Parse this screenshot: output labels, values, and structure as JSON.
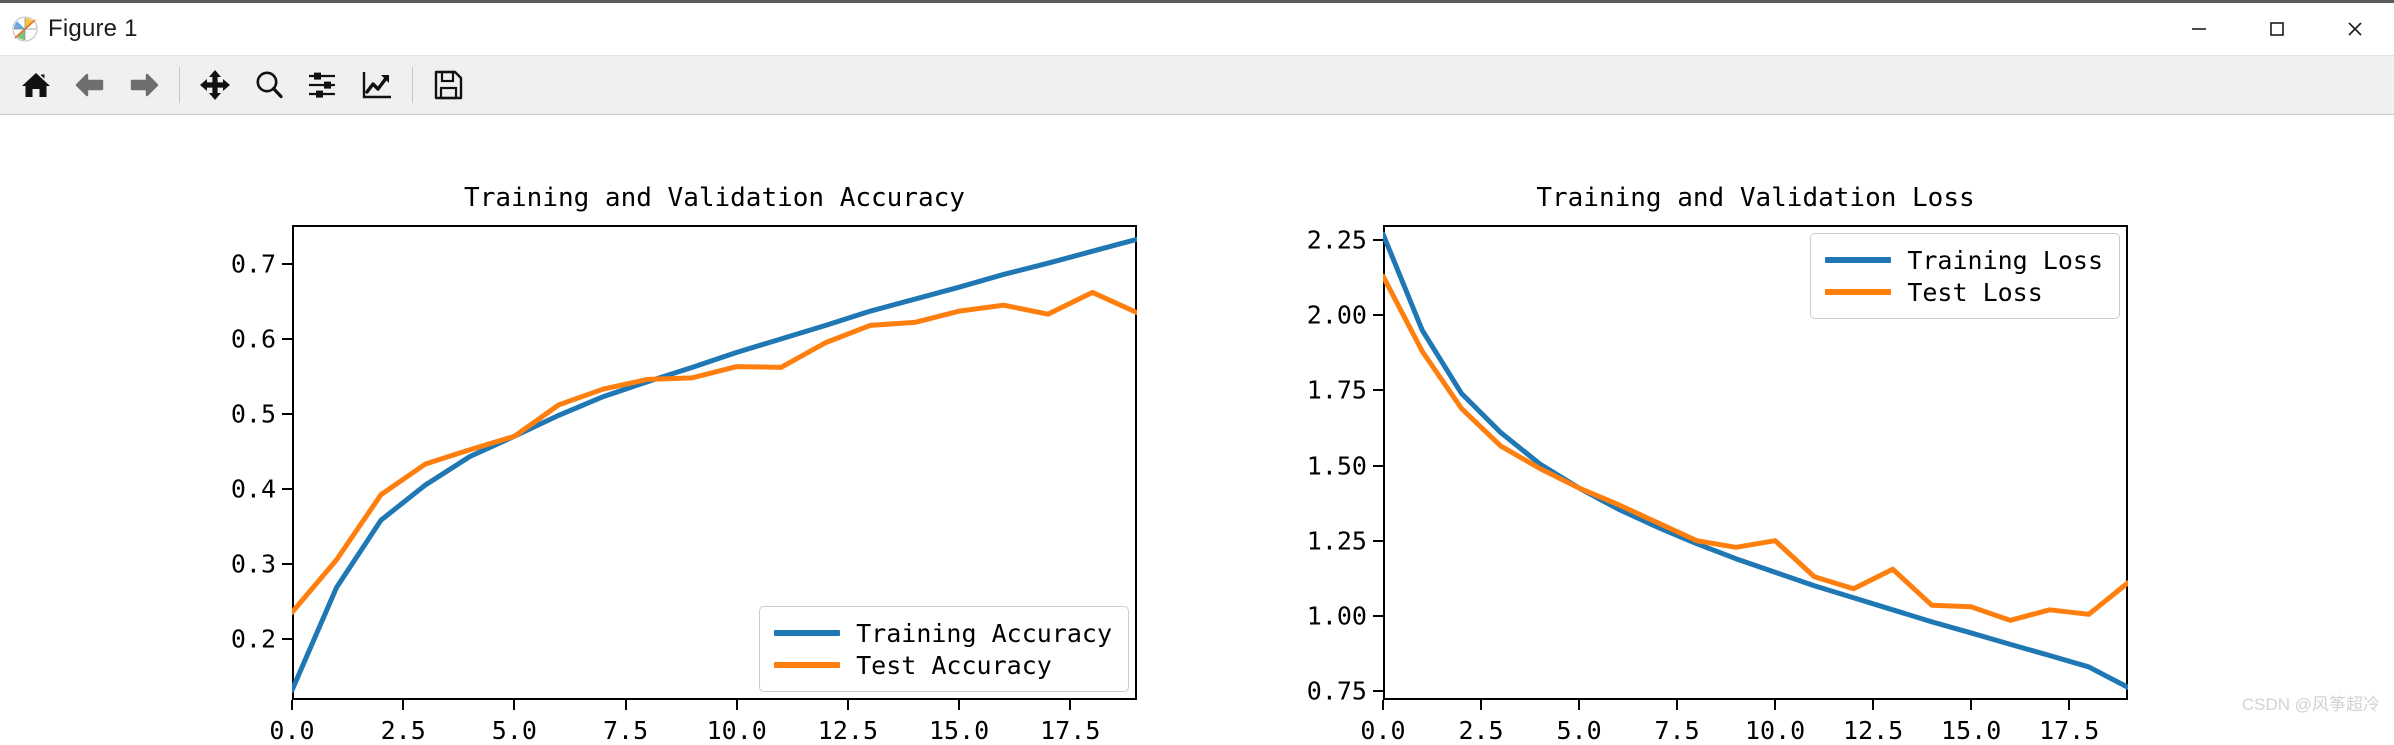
{
  "window": {
    "title": "Figure 1",
    "app_icon": "matplotlib-icon",
    "controls": {
      "minimize": "minimize-icon",
      "maximize": "maximize-icon",
      "close": "close-icon"
    }
  },
  "toolbar": {
    "buttons": [
      {
        "name": "home-button",
        "icon": "home-icon",
        "tooltip": "Reset original view",
        "enabled": true
      },
      {
        "name": "back-button",
        "icon": "arrow-left-icon",
        "tooltip": "Back to previous view",
        "enabled": false
      },
      {
        "name": "forward-button",
        "icon": "arrow-right-icon",
        "tooltip": "Forward to next view",
        "enabled": false
      },
      {
        "name": "pan-button",
        "icon": "move-icon",
        "tooltip": "Pan axes with left mouse, zoom with right",
        "enabled": true
      },
      {
        "name": "zoom-button",
        "icon": "magnifier-icon",
        "tooltip": "Zoom to rectangle",
        "enabled": true
      },
      {
        "name": "configure-subplots-button",
        "icon": "sliders-icon",
        "tooltip": "Configure subplots",
        "enabled": true
      },
      {
        "name": "edit-curves-button",
        "icon": "line-chart-icon",
        "tooltip": "Edit axis, curve and image parameters",
        "enabled": true
      },
      {
        "name": "save-button",
        "icon": "floppy-disk-icon",
        "tooltip": "Save the figure",
        "enabled": true
      }
    ]
  },
  "watermark": "CSDN @风筝超冷",
  "colors": {
    "training": "#1f77b4",
    "test": "#ff7f0e",
    "axis": "#000000",
    "toolbar_bg": "#f0f0f0",
    "disabled_icon": "#6e6e6e"
  },
  "chart_data": [
    {
      "type": "line",
      "title": "Training and Validation Accuracy",
      "xlabel": "",
      "ylabel": "",
      "xlim": [
        0,
        19
      ],
      "ylim": [
        0.118,
        0.752
      ],
      "grid": false,
      "legend_position": "lower right",
      "xticks": [
        "0.0",
        "2.5",
        "5.0",
        "7.5",
        "10.0",
        "12.5",
        "15.0",
        "17.5"
      ],
      "xtick_values": [
        0,
        2.5,
        5,
        7.5,
        10,
        12.5,
        15,
        17.5
      ],
      "yticks": [
        "0.2",
        "0.3",
        "0.4",
        "0.5",
        "0.6",
        "0.7"
      ],
      "ytick_values": [
        0.2,
        0.3,
        0.4,
        0.5,
        0.6,
        0.7
      ],
      "x": [
        0,
        1,
        2,
        3,
        4,
        5,
        6,
        7,
        8,
        9,
        10,
        11,
        12,
        13,
        14,
        15,
        16,
        17,
        18,
        19
      ],
      "series": [
        {
          "name": "Training Accuracy",
          "color": "#1f77b4",
          "values": [
            0.131,
            0.268,
            0.358,
            0.405,
            0.443,
            0.47,
            0.498,
            0.523,
            0.543,
            0.562,
            0.582,
            0.6,
            0.618,
            0.637,
            0.653,
            0.669,
            0.686,
            0.701,
            0.717,
            0.733
          ]
        },
        {
          "name": "Test Accuracy",
          "color": "#ff7f0e",
          "values": [
            0.235,
            0.305,
            0.392,
            0.433,
            0.452,
            0.47,
            0.512,
            0.533,
            0.546,
            0.548,
            0.563,
            0.562,
            0.595,
            0.618,
            0.622,
            0.637,
            0.645,
            0.633,
            0.662,
            0.635
          ]
        }
      ]
    },
    {
      "type": "line",
      "title": "Training and Validation Loss",
      "xlabel": "",
      "ylabel": "",
      "xlim": [
        0,
        19
      ],
      "ylim": [
        0.72,
        2.3
      ],
      "grid": false,
      "legend_position": "upper right",
      "xticks": [
        "0.0",
        "2.5",
        "5.0",
        "7.5",
        "10.0",
        "12.5",
        "15.0",
        "17.5"
      ],
      "xtick_values": [
        0,
        2.5,
        5,
        7.5,
        10,
        12.5,
        15,
        17.5
      ],
      "yticks": [
        "0.75",
        "1.00",
        "1.25",
        "1.50",
        "1.75",
        "2.00",
        "2.25"
      ],
      "ytick_values": [
        0.75,
        1.0,
        1.25,
        1.5,
        1.75,
        2.0,
        2.25
      ],
      "x": [
        0,
        1,
        2,
        3,
        4,
        5,
        6,
        7,
        8,
        9,
        10,
        11,
        12,
        13,
        14,
        15,
        16,
        17,
        18,
        19
      ],
      "series": [
        {
          "name": "Training Loss",
          "color": "#1f77b4",
          "values": [
            2.27,
            1.95,
            1.74,
            1.61,
            1.505,
            1.425,
            1.355,
            1.295,
            1.24,
            1.19,
            1.145,
            1.1,
            1.06,
            1.02,
            0.98,
            0.943,
            0.905,
            0.868,
            0.83,
            0.762
          ]
        },
        {
          "name": "Test Loss",
          "color": "#ff7f0e",
          "values": [
            2.13,
            1.88,
            1.69,
            1.565,
            1.49,
            1.425,
            1.37,
            1.31,
            1.25,
            1.228,
            1.25,
            1.13,
            1.09,
            1.155,
            1.035,
            1.03,
            0.985,
            1.02,
            1.005,
            1.11
          ]
        }
      ]
    }
  ]
}
